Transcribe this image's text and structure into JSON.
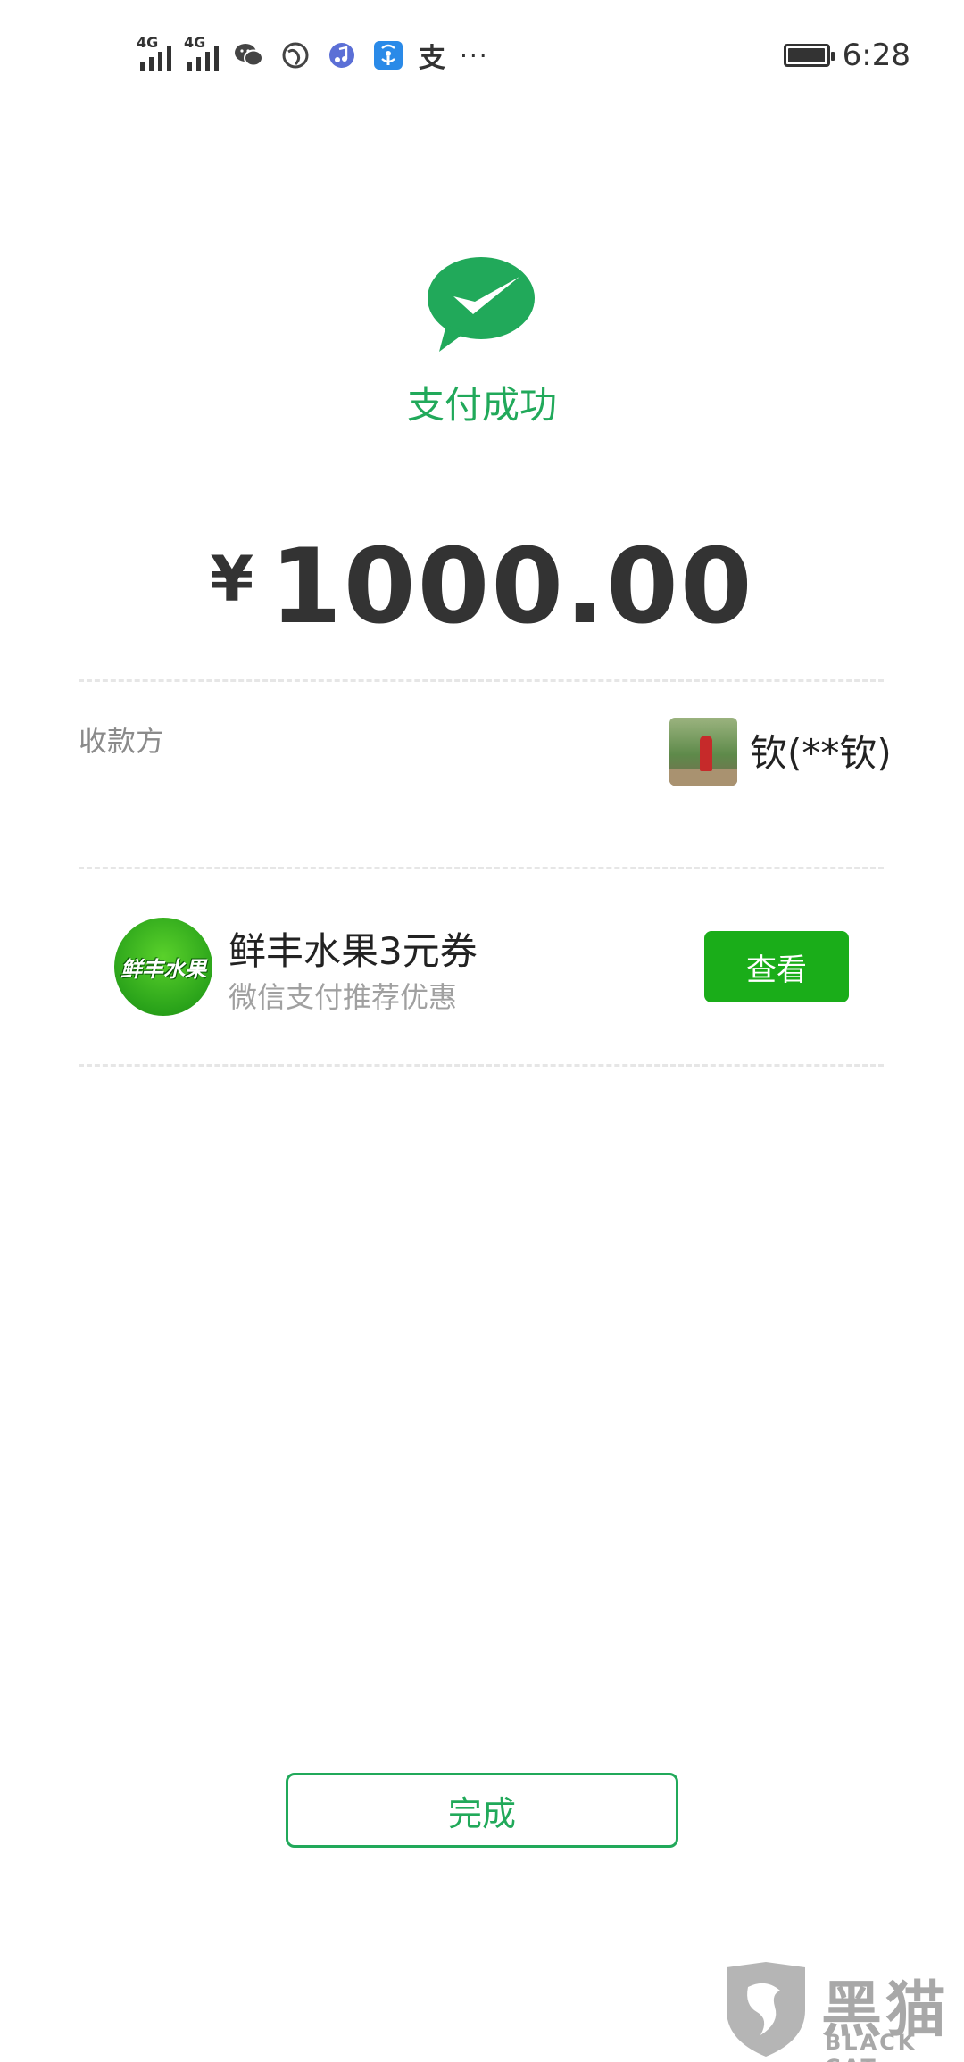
{
  "status_bar": {
    "network_1": "4G",
    "network_2": "4G",
    "extra_app_label": "支",
    "more": "···",
    "battery_level": 0.9,
    "time": "6:28"
  },
  "header": {
    "icon": "wechat-pay-check-icon",
    "title": "支付成功"
  },
  "payment": {
    "currency_symbol": "¥",
    "amount": "1000.00"
  },
  "payee": {
    "label": "收款方",
    "name": "钦(**钦)"
  },
  "coupon": {
    "logo_text": "鲜丰水果",
    "title": "鲜丰水果3元券",
    "subtitle": "微信支付推荐优惠",
    "button_label": "查看"
  },
  "footer": {
    "done_label": "完成"
  },
  "watermark": {
    "cn": "黑猫",
    "en": "BLACK CAT"
  },
  "colors": {
    "primary_green": "#21a95a",
    "button_green": "#1aad19",
    "text_dark": "#222222",
    "text_muted": "#8a8a8a"
  }
}
